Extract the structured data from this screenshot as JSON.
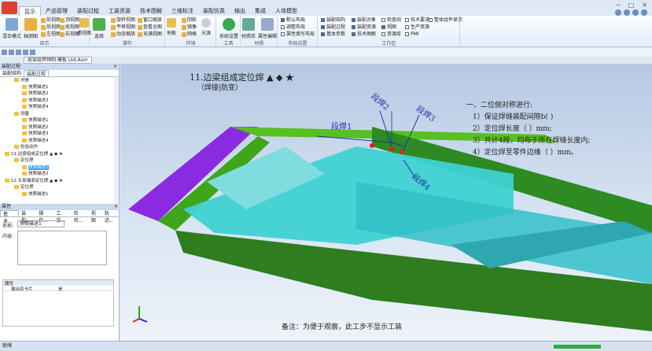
{
  "ribbon": {
    "tabs": [
      "显示",
      "产品管理",
      "装配过程",
      "工装资源",
      "技术图解",
      "三维标注",
      "装配仿真",
      "输出",
      "集成",
      "人体模型"
    ],
    "display": {
      "group_label": "显示",
      "mode": "混合模式",
      "axis": "轴测图",
      "views": [
        "前视图",
        "后视图",
        "左视图",
        "顶视图",
        "底视图",
        "右视图"
      ],
      "through": "透视图"
    },
    "ops": {
      "group_label": "操作",
      "select": "选择",
      "items": [
        "旋转视图",
        "平移视图",
        "动态缩放",
        "窗口缩放",
        "查看全图",
        "充满视图"
      ]
    },
    "env": {
      "group_label": "环境",
      "items": [
        "地板",
        "阴影",
        "镜像",
        "网格"
      ],
      "light": "光源"
    },
    "tools": {
      "group_label": "工具",
      "system": "系统设置"
    },
    "material": {
      "group_label": "材质",
      "lib": "材质库",
      "edit": "属性编辑"
    },
    "layout": {
      "group_label": "布局设置",
      "items": [
        "默认布局",
        "调整布局",
        "属性填写布局"
      ]
    },
    "workspace": {
      "group_label": "工作区",
      "items": [
        "装配结构",
        "装配对象",
        "检查阅",
        "技术要求",
        "整体组件显示",
        "装配过程",
        "装配资源",
        "视图",
        "生产资源",
        "基本参数",
        "技术图解",
        "资源库",
        "PMI"
      ]
    }
  },
  "doc_tab": "底架组焊预制.模板.Uid.Asm",
  "left": {
    "panel_title": "装配过程",
    "subtabs": [
      "装配结构",
      "装配过程"
    ],
    "tree": [
      "测量",
      "快照描述1",
      "快照描述2",
      "快照描述3",
      "快照描述4",
      "测量",
      "快照描述1",
      "快照描述2",
      "快照描述3",
      "快照描述4",
      "检验动作",
      "11.边梁组成定位焊 ▲ ◆ ★",
      "定位焊",
      "快照描述1",
      "快照描述2",
      "12.头部端梁定位焊 ▲ ◆ ★",
      "定位焊",
      "快照描述1"
    ],
    "props_title": "属性",
    "props_tabs": [
      "基本...",
      "装配...",
      "操作...",
      "工装...",
      "检验...",
      "视图",
      "轨迹..."
    ],
    "name_label": "名称:",
    "name_value": "快照描述1",
    "content_label": "内容:",
    "section": "属性",
    "grid_col1": "输出到卡片",
    "grid_col2": "是"
  },
  "view": {
    "title": "11.边梁组成定位焊 ▲ ◆ ★",
    "subtitle": "（焊接|防变）",
    "notes": [
      "一、二位侧对称进行:",
      "1）保证焊缝装配间隙b(              )",
      "2）定位焊长度（        ）mm;",
      "3）共计4段，均布于所在焊缝长度内;",
      "4）定位焊至零件边缘（          ）mm。"
    ],
    "labels": [
      "段焊1",
      "段焊2",
      "段焊3",
      "段焊4"
    ],
    "remark": "备注：为便于观察，此工步不显示工装",
    "axis": {
      "x": "X",
      "y": "Y",
      "z": "Z"
    }
  },
  "status": "就绪"
}
